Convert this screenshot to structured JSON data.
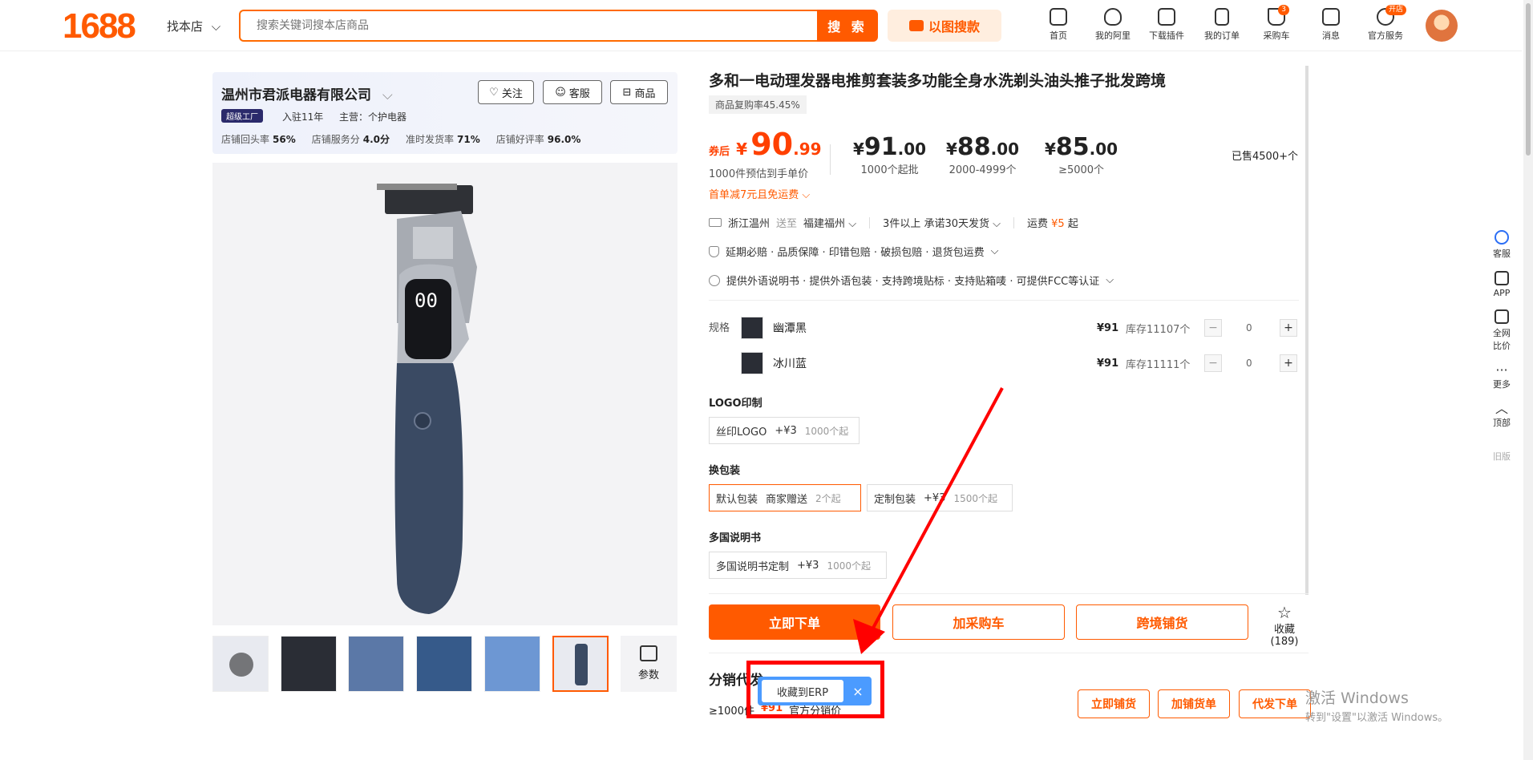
{
  "header": {
    "logo": "1688",
    "find_shop": "找本店",
    "search_placeholder": "搜索关键词搜本店商品",
    "search_button": "搜 索",
    "image_search": "以图搜款",
    "nav": [
      {
        "label": "首页",
        "icon": "home-icon"
      },
      {
        "label": "我的阿里",
        "icon": "heart-shield-icon"
      },
      {
        "label": "下载插件",
        "icon": "puzzle-icon"
      },
      {
        "label": "我的订单",
        "icon": "clipboard-icon"
      },
      {
        "label": "采购车",
        "icon": "cart-icon",
        "badge": "3"
      },
      {
        "label": "消息",
        "icon": "message-icon"
      },
      {
        "label": "官方服务",
        "icon": "user-service-icon",
        "badge": "开店"
      }
    ]
  },
  "shop": {
    "name": "温州市君派电器有限公司",
    "follow": "关注",
    "service": "客服",
    "goods": "商品",
    "factory_tag": "超级工厂",
    "years": "入驻11年",
    "main": "主营：个护电器",
    "stats": [
      {
        "label": "店铺回头率",
        "value": "56%"
      },
      {
        "label": "店铺服务分",
        "value": "4.0分"
      },
      {
        "label": "准时发货率",
        "value": "71%"
      },
      {
        "label": "店铺好评率",
        "value": "96.0%"
      }
    ]
  },
  "gallery": {
    "params": "参数"
  },
  "product": {
    "title": "多和一电动理发器电推剪套装多功能全身水洗剃头油头推子批发跨境",
    "repurchase": "商品复购率45.45%",
    "coupon_label": "券后",
    "coupon_currency": "¥",
    "coupon_int": "90",
    "coupon_dec": ".99",
    "coupon_note": "1000件预估到手单价",
    "discount": "首单减7元且免运费",
    "tiers": [
      {
        "int": "91",
        "dec": ".00",
        "note": "1000个起批"
      },
      {
        "int": "88",
        "dec": ".00",
        "note": "2000-4999个"
      },
      {
        "int": "85",
        "dec": ".00",
        "note": "≥5000个"
      }
    ],
    "sold": "已售4500+个",
    "ship_from": "浙江温州",
    "ship_to_word": "送至",
    "ship_to": "福建福州",
    "ship_promise": "3件以上  承诺30天发货",
    "freight_label": "运费",
    "freight_value": "¥5",
    "freight_suffix": "起",
    "guarantees": "延期必赔 · 品质保障 · 印错包赔 · 破损包赔 · 退货包运费",
    "services": "提供外语说明书 · 提供外语包装 · 支持跨境贴标 · 支持贴箱唛 · 可提供FCC等认证",
    "spec_label": "规格",
    "specs": [
      {
        "name": "幽潭黑",
        "price": "¥91",
        "stock": "库存11107个",
        "qty": "0"
      },
      {
        "name": "冰川蓝",
        "price": "¥91",
        "stock": "库存11111个",
        "qty": "0"
      }
    ],
    "logo_title": "LOGO印制",
    "logo_opt": {
      "name": "丝印LOGO",
      "price": "+¥3",
      "min": "1000个起"
    },
    "pack_title": "换包装",
    "pack_opts": [
      {
        "name": "默认包装",
        "extra": "商家赠送",
        "min": "2个起"
      },
      {
        "name": "定制包装",
        "extra": "+¥3",
        "min": "1500个起"
      }
    ],
    "manual_title": "多国说明书",
    "manual_opt": {
      "name": "多国说明书定制",
      "price": "+¥3",
      "min": "1000个起"
    }
  },
  "actions": {
    "buy_now": "立即下单",
    "add_cart": "加采购车",
    "cross_border": "跨境铺货",
    "collect": "收藏",
    "collect_count": "(189)"
  },
  "distribution": {
    "title": "分销代发",
    "line_start": "≥1000件",
    "line_price": "¥91",
    "line_end": "官方分销价",
    "btn1": "立即铺货",
    "btn2": "加铺货单",
    "btn3": "代发下单"
  },
  "popup": {
    "label": "收藏到ERP",
    "close": "×"
  },
  "right_sidebar": [
    "客服",
    "APP",
    "全网比价",
    "更多",
    "顶部",
    "旧版"
  ],
  "watermark": {
    "line1": "激活 Windows",
    "line2": "转到\"设置\"以激活 Windows。"
  },
  "colors": {
    "accent": "#ff5a00",
    "price": "#ff4000",
    "popup_blue": "#4b9bff",
    "highlight_red": "#ff0000"
  }
}
